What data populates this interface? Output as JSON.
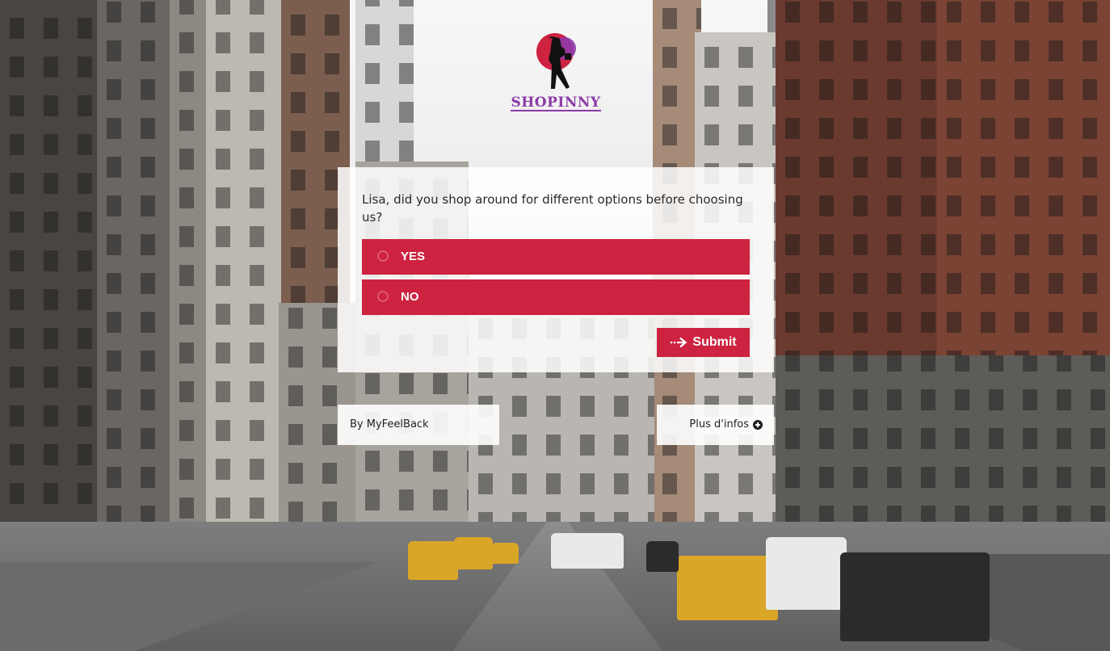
{
  "brand": {
    "name": "SHOPINNY",
    "colors": {
      "logo_circle": "#cd2240",
      "logo_text": "#8e3aa8"
    }
  },
  "survey": {
    "question": "Lisa, did you shop around for different options before choosing us?",
    "options": [
      {
        "label": "YES",
        "selected": false
      },
      {
        "label": "NO",
        "selected": false
      }
    ],
    "submit_label": "Submit",
    "submit_icon": "arrow-right-icon",
    "accent_color": "#cd2240"
  },
  "footer": {
    "by_label": "By MyFeelBack",
    "more_label": "Plus d'infos",
    "more_icon": "plus-circle-icon"
  }
}
